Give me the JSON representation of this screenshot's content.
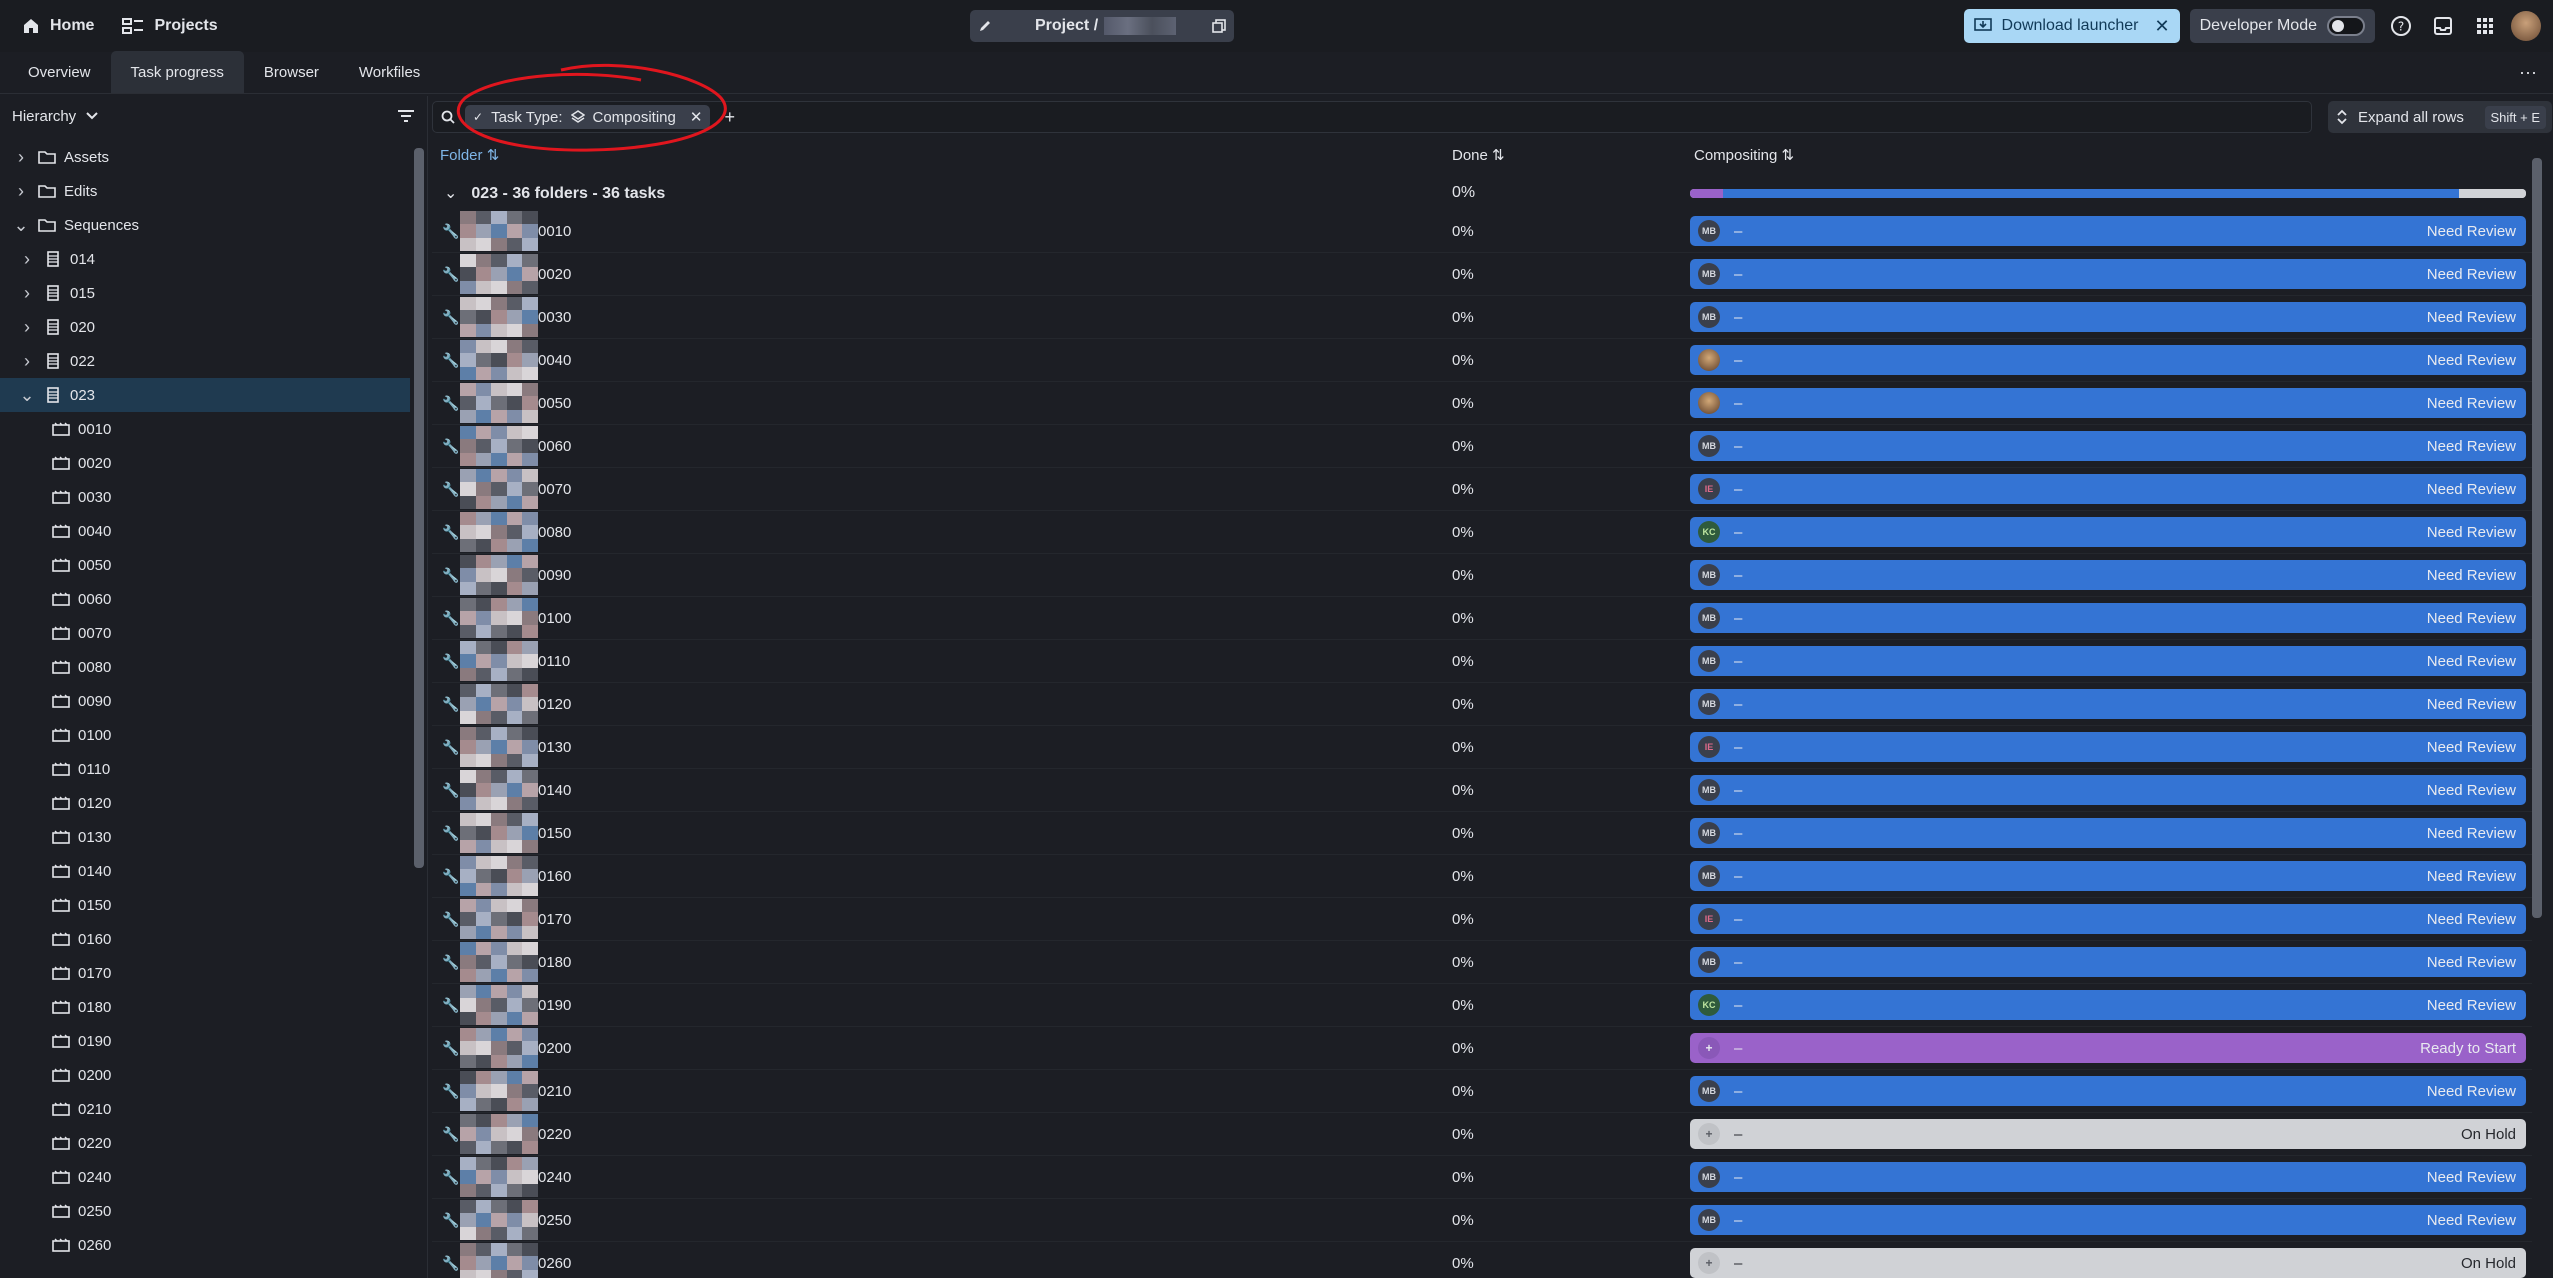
{
  "topbar": {
    "home_label": "Home",
    "projects_label": "Projects",
    "project_prefix": "Project /",
    "download_label": "Download launcher",
    "developer_mode_label": "Developer Mode"
  },
  "tabs": [
    "Overview",
    "Task progress",
    "Browser",
    "Workfiles"
  ],
  "sidebar": {
    "mode_label": "Hierarchy",
    "tree": [
      {
        "label": "Assets",
        "level": 0,
        "expanded": false,
        "icon": "folder-icon"
      },
      {
        "label": "Edits",
        "level": 0,
        "expanded": false,
        "icon": "folder-icon"
      },
      {
        "label": "Sequences",
        "level": 0,
        "expanded": true,
        "icon": "folder-icon"
      },
      {
        "label": "014",
        "level": 1,
        "expanded": false,
        "icon": "sequence-icon"
      },
      {
        "label": "015",
        "level": 1,
        "expanded": false,
        "icon": "sequence-icon"
      },
      {
        "label": "020",
        "level": 1,
        "expanded": false,
        "icon": "sequence-icon"
      },
      {
        "label": "022",
        "level": 1,
        "expanded": false,
        "icon": "sequence-icon"
      },
      {
        "label": "023",
        "level": 1,
        "expanded": true,
        "icon": "sequence-icon",
        "selected": true
      },
      {
        "label": "0010",
        "level": 2,
        "icon": "shot-icon"
      },
      {
        "label": "0020",
        "level": 2,
        "icon": "shot-icon"
      },
      {
        "label": "0030",
        "level": 2,
        "icon": "shot-icon"
      },
      {
        "label": "0040",
        "level": 2,
        "icon": "shot-icon"
      },
      {
        "label": "0050",
        "level": 2,
        "icon": "shot-icon"
      },
      {
        "label": "0060",
        "level": 2,
        "icon": "shot-icon"
      },
      {
        "label": "0070",
        "level": 2,
        "icon": "shot-icon"
      },
      {
        "label": "0080",
        "level": 2,
        "icon": "shot-icon"
      },
      {
        "label": "0090",
        "level": 2,
        "icon": "shot-icon"
      },
      {
        "label": "0100",
        "level": 2,
        "icon": "shot-icon"
      },
      {
        "label": "0110",
        "level": 2,
        "icon": "shot-icon"
      },
      {
        "label": "0120",
        "level": 2,
        "icon": "shot-icon"
      },
      {
        "label": "0130",
        "level": 2,
        "icon": "shot-icon"
      },
      {
        "label": "0140",
        "level": 2,
        "icon": "shot-icon"
      },
      {
        "label": "0150",
        "level": 2,
        "icon": "shot-icon"
      },
      {
        "label": "0160",
        "level": 2,
        "icon": "shot-icon"
      },
      {
        "label": "0170",
        "level": 2,
        "icon": "shot-icon"
      },
      {
        "label": "0180",
        "level": 2,
        "icon": "shot-icon"
      },
      {
        "label": "0190",
        "level": 2,
        "icon": "shot-icon"
      },
      {
        "label": "0200",
        "level": 2,
        "icon": "shot-icon"
      },
      {
        "label": "0210",
        "level": 2,
        "icon": "shot-icon"
      },
      {
        "label": "0220",
        "level": 2,
        "icon": "shot-icon"
      },
      {
        "label": "0240",
        "level": 2,
        "icon": "shot-icon"
      },
      {
        "label": "0250",
        "level": 2,
        "icon": "shot-icon"
      },
      {
        "label": "0260",
        "level": 2,
        "icon": "shot-icon"
      }
    ]
  },
  "filter": {
    "chip_label": "Task Type:",
    "chip_value": "Compositing"
  },
  "expand_all_label": "Expand all rows",
  "expand_all_shortcut": "Shift + E",
  "columns": {
    "folder": "Folder",
    "done": "Done",
    "task": "Compositing"
  },
  "group": {
    "label": "023 - 36 folders - 36 tasks",
    "done": "0%"
  },
  "status_colors": {
    "Need Review": "#3474d4",
    "Ready to Start": "#9a62c9",
    "On Hold": "#d0d2d6"
  },
  "rows": [
    {
      "name": "0010",
      "done": "0%",
      "assignee": "MB",
      "status": "Need Review",
      "note": "–"
    },
    {
      "name": "0020",
      "done": "0%",
      "assignee": "MB",
      "status": "Need Review",
      "note": "–"
    },
    {
      "name": "0030",
      "done": "0%",
      "assignee": "MB",
      "status": "Need Review",
      "note": "–"
    },
    {
      "name": "0040",
      "done": "0%",
      "assignee": "",
      "status": "Need Review",
      "note": "–"
    },
    {
      "name": "0050",
      "done": "0%",
      "assignee": "",
      "status": "Need Review",
      "note": "–"
    },
    {
      "name": "0060",
      "done": "0%",
      "assignee": "MB",
      "status": "Need Review",
      "note": "–"
    },
    {
      "name": "0070",
      "done": "0%",
      "assignee": "IE",
      "status": "Need Review",
      "note": "–"
    },
    {
      "name": "0080",
      "done": "0%",
      "assignee": "KC",
      "status": "Need Review",
      "note": "–"
    },
    {
      "name": "0090",
      "done": "0%",
      "assignee": "MB",
      "status": "Need Review",
      "note": "–"
    },
    {
      "name": "0100",
      "done": "0%",
      "assignee": "MB",
      "status": "Need Review",
      "note": "–"
    },
    {
      "name": "0110",
      "done": "0%",
      "assignee": "MB",
      "status": "Need Review",
      "note": "–"
    },
    {
      "name": "0120",
      "done": "0%",
      "assignee": "MB",
      "status": "Need Review",
      "note": "–"
    },
    {
      "name": "0130",
      "done": "0%",
      "assignee": "IE",
      "status": "Need Review",
      "note": "–"
    },
    {
      "name": "0140",
      "done": "0%",
      "assignee": "MB",
      "status": "Need Review",
      "note": "–"
    },
    {
      "name": "0150",
      "done": "0%",
      "assignee": "MB",
      "status": "Need Review",
      "note": "–"
    },
    {
      "name": "0160",
      "done": "0%",
      "assignee": "MB",
      "status": "Need Review",
      "note": "–"
    },
    {
      "name": "0170",
      "done": "0%",
      "assignee": "IE",
      "status": "Need Review",
      "note": "–"
    },
    {
      "name": "0180",
      "done": "0%",
      "assignee": "MB",
      "status": "Need Review",
      "note": "–"
    },
    {
      "name": "0190",
      "done": "0%",
      "assignee": "KC",
      "status": "Need Review",
      "note": "–"
    },
    {
      "name": "0200",
      "done": "0%",
      "assignee": "",
      "status": "Ready to Start",
      "note": "–"
    },
    {
      "name": "0210",
      "done": "0%",
      "assignee": "MB",
      "status": "Need Review",
      "note": "–"
    },
    {
      "name": "0220",
      "done": "0%",
      "assignee": "",
      "status": "On Hold",
      "note": "–"
    },
    {
      "name": "0240",
      "done": "0%",
      "assignee": "MB",
      "status": "Need Review",
      "note": "–"
    },
    {
      "name": "0250",
      "done": "0%",
      "assignee": "MB",
      "status": "Need Review",
      "note": "–"
    },
    {
      "name": "0260",
      "done": "0%",
      "assignee": "",
      "status": "On Hold",
      "note": "–"
    }
  ]
}
